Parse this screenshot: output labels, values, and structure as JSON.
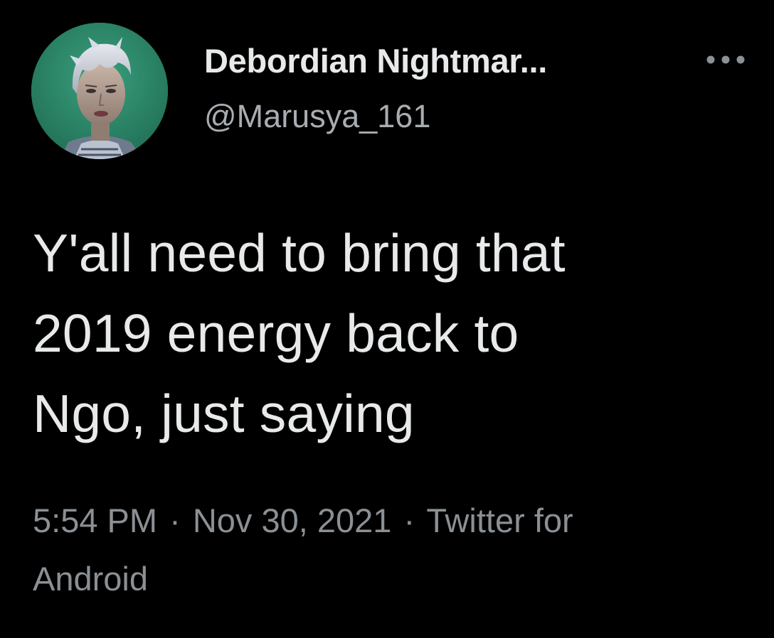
{
  "user": {
    "display_name": "Debordian Nightmar...",
    "handle": "@Marusya_161",
    "avatar_icon": "profile-avatar"
  },
  "more_icon": "more-horizontal-icon",
  "tweet": {
    "text_lines": [
      "Y'all need to bring that",
      "2019 energy back to",
      "Ngo, just saying"
    ],
    "time": "5:54 PM",
    "separator": "·",
    "date": "Nov 30, 2021",
    "source_line1": "Twitter for",
    "source_line2": "Android"
  },
  "colors": {
    "background": "#000000",
    "primary_text": "#e7e9ea",
    "secondary_text": "#8b9095"
  }
}
